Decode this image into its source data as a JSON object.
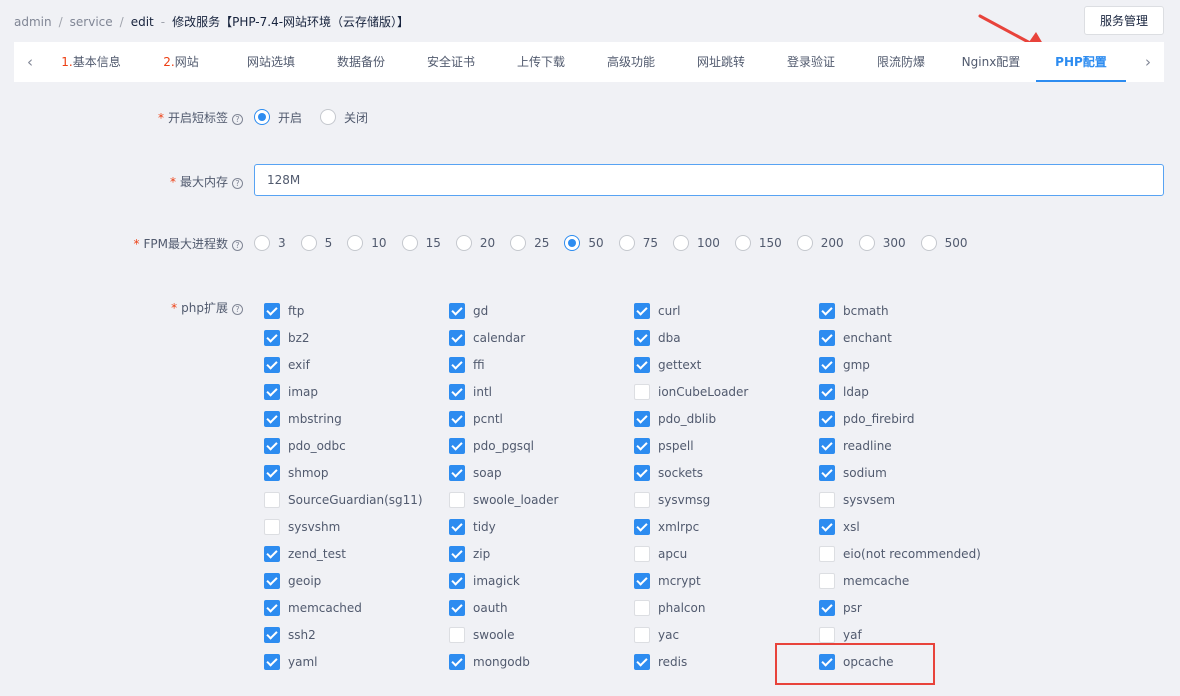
{
  "breadcrumb": [
    "admin",
    "service",
    "edit",
    "修改服务【PHP-7.4-网站环境（云存储版）】"
  ],
  "header": {
    "service_button": "服务管理"
  },
  "tabs": [
    {
      "num": "1.",
      "label": "基本信息",
      "active": false
    },
    {
      "num": "2.",
      "label": "网站",
      "active": false
    },
    {
      "num": "",
      "label": "网站选填",
      "active": false
    },
    {
      "num": "",
      "label": "数据备份",
      "active": false
    },
    {
      "num": "",
      "label": "安全证书",
      "active": false
    },
    {
      "num": "",
      "label": "上传下载",
      "active": false
    },
    {
      "num": "",
      "label": "高级功能",
      "active": false
    },
    {
      "num": "",
      "label": "网址跳转",
      "active": false
    },
    {
      "num": "",
      "label": "登录验证",
      "active": false
    },
    {
      "num": "",
      "label": "限流防爆",
      "active": false
    },
    {
      "num": "",
      "label": "Nginx配置",
      "active": false
    },
    {
      "num": "",
      "label": "PHP配置",
      "active": true
    }
  ],
  "form": {
    "short_tag": {
      "label": "开启短标签",
      "options": [
        {
          "label": "开启",
          "selected": true
        },
        {
          "label": "关闭",
          "selected": false
        }
      ]
    },
    "memory": {
      "label": "最大内存",
      "value": "128M"
    },
    "fpm": {
      "label": "FPM最大进程数",
      "options": [
        {
          "label": "3",
          "selected": false
        },
        {
          "label": "5",
          "selected": false
        },
        {
          "label": "10",
          "selected": false
        },
        {
          "label": "15",
          "selected": false
        },
        {
          "label": "20",
          "selected": false
        },
        {
          "label": "25",
          "selected": false
        },
        {
          "label": "50",
          "selected": true
        },
        {
          "label": "75",
          "selected": false
        },
        {
          "label": "100",
          "selected": false
        },
        {
          "label": "150",
          "selected": false
        },
        {
          "label": "200",
          "selected": false
        },
        {
          "label": "300",
          "selected": false
        },
        {
          "label": "500",
          "selected": false
        }
      ]
    },
    "extensions": {
      "label": "php扩展",
      "items": [
        {
          "name": "ftp",
          "checked": true
        },
        {
          "name": "gd",
          "checked": true
        },
        {
          "name": "curl",
          "checked": true
        },
        {
          "name": "bcmath",
          "checked": true
        },
        {
          "name": "bz2",
          "checked": true
        },
        {
          "name": "calendar",
          "checked": true
        },
        {
          "name": "dba",
          "checked": true
        },
        {
          "name": "enchant",
          "checked": true
        },
        {
          "name": "exif",
          "checked": true
        },
        {
          "name": "ffi",
          "checked": true
        },
        {
          "name": "gettext",
          "checked": true
        },
        {
          "name": "gmp",
          "checked": true
        },
        {
          "name": "imap",
          "checked": true
        },
        {
          "name": "intl",
          "checked": true
        },
        {
          "name": "ionCubeLoader",
          "checked": false
        },
        {
          "name": "ldap",
          "checked": true
        },
        {
          "name": "mbstring",
          "checked": true
        },
        {
          "name": "pcntl",
          "checked": true
        },
        {
          "name": "pdo_dblib",
          "checked": true
        },
        {
          "name": "pdo_firebird",
          "checked": true
        },
        {
          "name": "pdo_odbc",
          "checked": true
        },
        {
          "name": "pdo_pgsql",
          "checked": true
        },
        {
          "name": "pspell",
          "checked": true
        },
        {
          "name": "readline",
          "checked": true
        },
        {
          "name": "shmop",
          "checked": true
        },
        {
          "name": "soap",
          "checked": true
        },
        {
          "name": "sockets",
          "checked": true
        },
        {
          "name": "sodium",
          "checked": true
        },
        {
          "name": "SourceGuardian(sg11)",
          "checked": false
        },
        {
          "name": "swoole_loader",
          "checked": false
        },
        {
          "name": "sysvmsg",
          "checked": false
        },
        {
          "name": "sysvsem",
          "checked": false
        },
        {
          "name": "sysvshm",
          "checked": false
        },
        {
          "name": "tidy",
          "checked": true
        },
        {
          "name": "xmlrpc",
          "checked": true
        },
        {
          "name": "xsl",
          "checked": true
        },
        {
          "name": "zend_test",
          "checked": true
        },
        {
          "name": "zip",
          "checked": true
        },
        {
          "name": "apcu",
          "checked": false
        },
        {
          "name": "eio(not recommended)",
          "checked": false
        },
        {
          "name": "geoip",
          "checked": true
        },
        {
          "name": "imagick",
          "checked": true
        },
        {
          "name": "mcrypt",
          "checked": true
        },
        {
          "name": "memcache",
          "checked": false
        },
        {
          "name": "memcached",
          "checked": true
        },
        {
          "name": "oauth",
          "checked": true
        },
        {
          "name": "phalcon",
          "checked": false
        },
        {
          "name": "psr",
          "checked": true
        },
        {
          "name": "ssh2",
          "checked": true
        },
        {
          "name": "swoole",
          "checked": false
        },
        {
          "name": "yac",
          "checked": false
        },
        {
          "name": "yaf",
          "checked": false
        },
        {
          "name": "yaml",
          "checked": true
        },
        {
          "name": "mongodb",
          "checked": true
        },
        {
          "name": "redis",
          "checked": true
        },
        {
          "name": "opcache",
          "checked": true
        }
      ]
    }
  },
  "colors": {
    "primary": "#2d8cf0",
    "required": "#ed4014",
    "annotation": "#e8433b",
    "background": "#f0f1f5"
  }
}
